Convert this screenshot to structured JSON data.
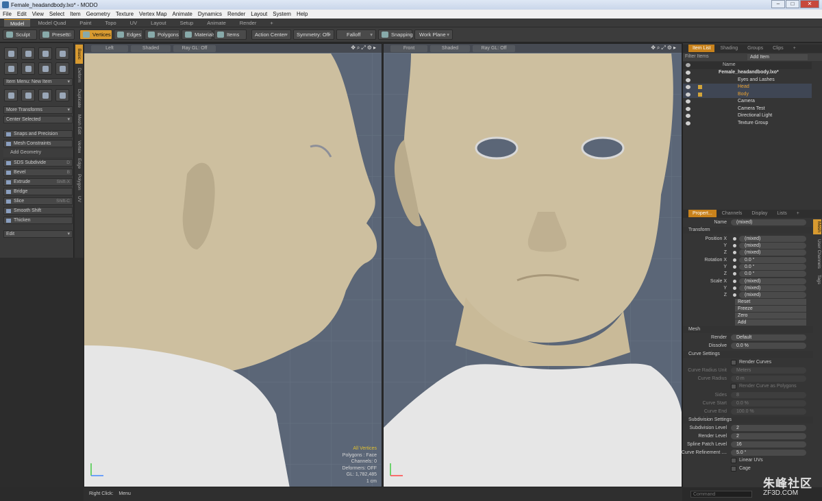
{
  "window": {
    "title": "Female_headandbody.lxo* - MODO"
  },
  "menu": [
    "File",
    "Edit",
    "View",
    "Select",
    "Item",
    "Geometry",
    "Texture",
    "Vertex Map",
    "Animate",
    "Dynamics",
    "Render",
    "Layout",
    "System",
    "Help"
  ],
  "layout_tabs": [
    "Model",
    "Model Quad",
    "Paint",
    "Topo",
    "UV",
    "Layout",
    "Setup",
    "Animate",
    "Render",
    "+"
  ],
  "toolbar": {
    "sculpt": "Sculpt",
    "presets": "Presets",
    "presets_key": "F6",
    "vertices": "Vertices",
    "edges": "Edges",
    "polygons": "Polygons",
    "materials": "Materials",
    "items": "Items",
    "action_center": "Action Center",
    "symmetry": "Symmetry: Off",
    "falloff": "Falloff",
    "snapping": "Snapping",
    "work_plane": "Work Plane"
  },
  "left_panel": {
    "item_menu": "Item Menu: New Item",
    "more_transforms": "More Transforms",
    "center_selected": "Center Selected",
    "snaps": "Snaps and Precision",
    "mesh_constraints": "Mesh Constraints",
    "add_geometry": "Add Geometry",
    "tools": [
      {
        "label": "SDS Subdivide",
        "key": "D"
      },
      {
        "label": "Bevel",
        "key": "B"
      },
      {
        "label": "Extrude",
        "key": "Shift-X"
      },
      {
        "label": "Bridge",
        "key": ""
      },
      {
        "label": "Slice",
        "key": "Shift-C"
      },
      {
        "label": "Smooth Shift",
        "key": ""
      },
      {
        "label": "Thicken",
        "key": ""
      }
    ],
    "edit": "Edit"
  },
  "vertical_tabs": [
    "Basic",
    "Deform",
    "Duplicate",
    "Mesh Edit",
    "Vertex",
    "Edge",
    "Polygon",
    "UV"
  ],
  "viewport_left": {
    "view": "Left",
    "shading": "Shaded",
    "ray": "Ray GL: Off"
  },
  "viewport_right": {
    "view": "Front",
    "shading": "Shaded",
    "ray": "Ray GL: Off"
  },
  "viewport_info": {
    "selection": "All Vertices",
    "polygons": "Polygons : Face",
    "channels": "Channels: 0",
    "deformers": "Deformers: OFF",
    "gl": "GL: 1,782,485",
    "unit": "1 cm"
  },
  "item_list": {
    "tabs": [
      "Item List",
      "Shading",
      "Groups",
      "Clips",
      "+"
    ],
    "filter": "Filter Items",
    "add_item": "Add Item",
    "name_header": "Name",
    "items": [
      {
        "name": "Female_headandbody.lxo*",
        "indent": 0
      },
      {
        "name": "Eyes and Lashes",
        "indent": 1
      },
      {
        "name": "Head",
        "indent": 1
      },
      {
        "name": "Body",
        "indent": 1
      },
      {
        "name": "Camera",
        "indent": 1
      },
      {
        "name": "Camera Test",
        "indent": 1
      },
      {
        "name": "Directional Light",
        "indent": 1
      },
      {
        "name": "Texture Group",
        "indent": 1
      }
    ]
  },
  "properties": {
    "tabs": [
      "Propert...",
      "Channels",
      "Display",
      "Lists",
      "+"
    ],
    "name_label": "Name",
    "name_value": "(mixed)",
    "transform": "Transform",
    "position_label": "Position X",
    "rotation_label": "Rotation X",
    "scale_label": "Scale X",
    "y": "Y",
    "z": "Z",
    "mixed": "(mixed)",
    "zero_deg": "0.0 °",
    "reset": "Reset",
    "freeze": "Freeze",
    "zero": "Zero",
    "add": "Add",
    "mesh": "Mesh",
    "render_label": "Render",
    "render_value": "Default",
    "dissolve_label": "Dissolve",
    "dissolve_value": "0.0 %",
    "curve_settings": "Curve Settings",
    "render_curves": "Render Curves",
    "curve_radius_unit_label": "Curve Radius Unit",
    "curve_radius_unit_value": "Meters",
    "curve_radius_label": "Curve Radius",
    "curve_radius_value": "0 m",
    "render_curve_polygons": "Render Curve as Polygons",
    "sides_label": "Sides",
    "sides_value": "8",
    "curve_start_label": "Curve Start",
    "curve_start_value": "0.0 %",
    "curve_end_label": "Curve End",
    "curve_end_value": "100.0 %",
    "subdivision_settings": "Subdivision Settings",
    "subdiv_level_label": "Subdivision Level",
    "subdiv_level_value": "2",
    "render_level_label": "Render Level",
    "render_level_value": "2",
    "spline_patch_label": "Spline Patch Level",
    "spline_patch_value": "16",
    "curve_refinement_label": "Curve Refinement ....",
    "curve_refinement_value": "5.0 °",
    "linear_uvs": "Linear UVs",
    "cage": "Cage",
    "side_tabs": [
      "Mesh",
      "User Channels",
      "Tags"
    ]
  },
  "status": {
    "right_click": "Right Click:",
    "menu": "Menu"
  },
  "command": {
    "placeholder": "Command"
  },
  "watermark": {
    "brand": "朱峰社区",
    "url": "ZF3D.COM"
  },
  "colors": {
    "accent": "#d89a30",
    "viewport_bg": "#5b6677",
    "skin": "#cdbf9f",
    "shirt": "#e6e6e6"
  }
}
